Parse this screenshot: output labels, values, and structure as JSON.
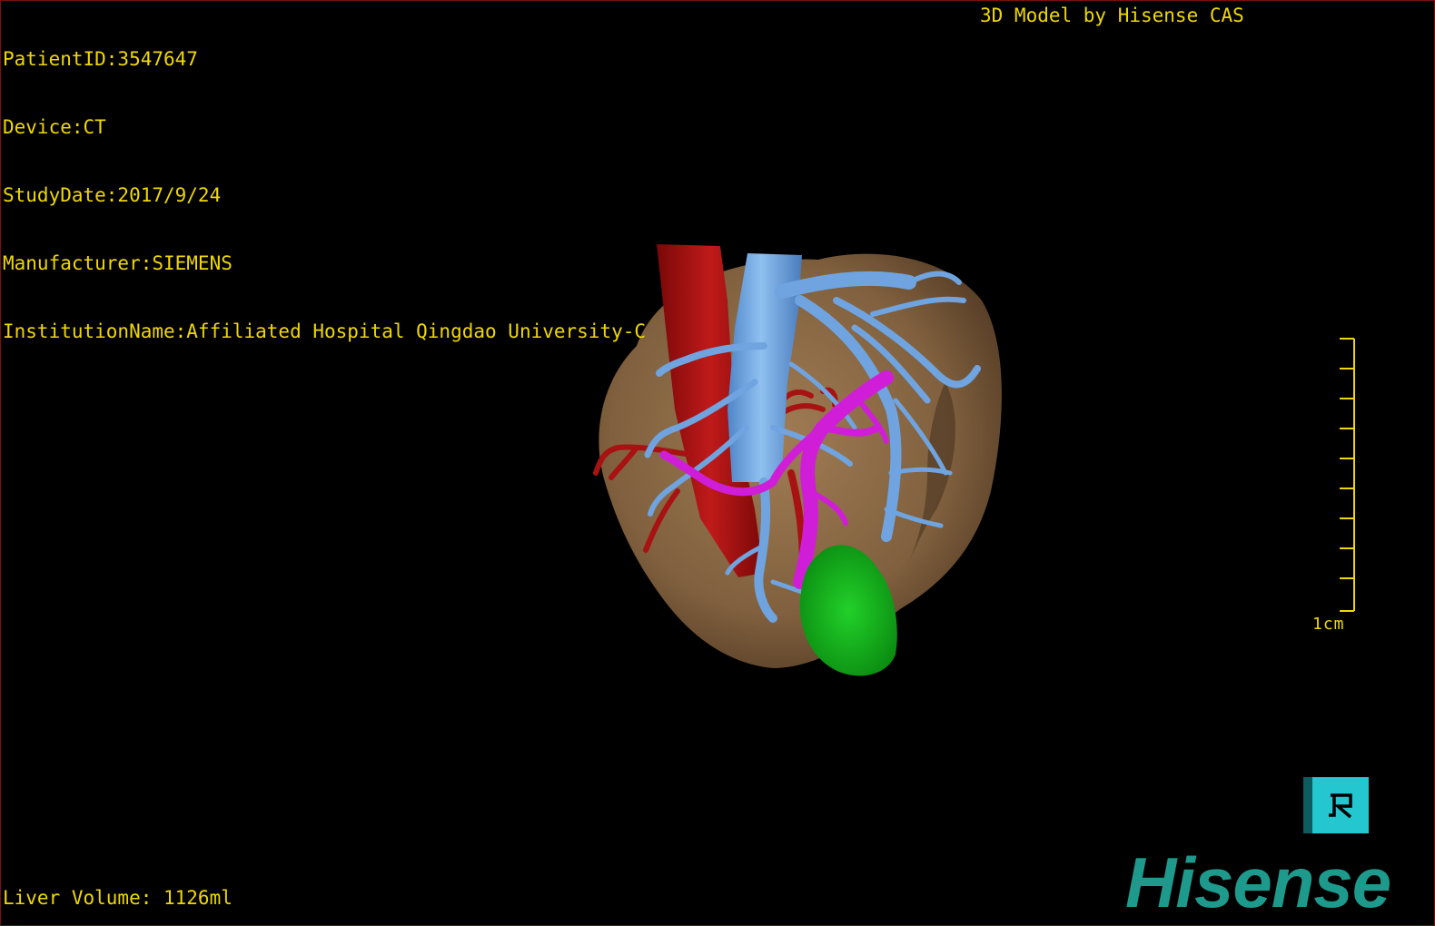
{
  "patient_info": {
    "patient_id": "PatientID:3547647",
    "device": "Device:CT",
    "study_date": "StudyDate:2017/9/24",
    "manufacturer": "Manufacturer:SIEMENS",
    "institution": "InstitutionName:Affiliated Hospital Qingdao University-C"
  },
  "credit": "3D Model by Hisense CAS",
  "liver_volume": "Liver Volume: 1126ml",
  "scale": {
    "label": "1cm",
    "ticks": 10
  },
  "orientation_button": {
    "label": "R"
  },
  "brand": "Hisense",
  "colors": {
    "text": "#f0d800",
    "liver": "#8a6a46",
    "artery": "#b01414",
    "hepatic_vein": "#6fa4e0",
    "portal_vein": "#d01ed8",
    "lesion": "#12b41a",
    "brand": "#1e9a8c",
    "orientation_button": "#24c6cf"
  }
}
